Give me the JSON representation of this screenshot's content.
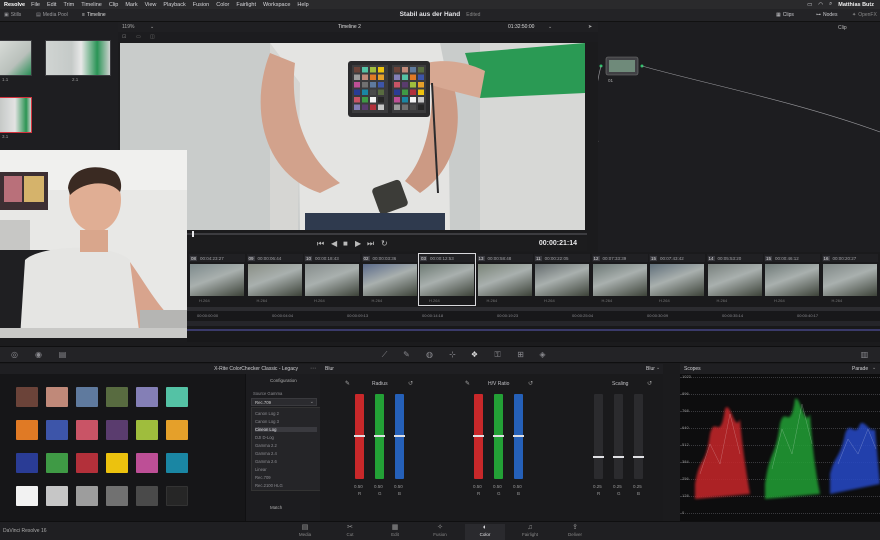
{
  "menubar": {
    "app": "Resolve",
    "items": [
      "File",
      "Edit",
      "Trim",
      "Timeline",
      "Clip",
      "Mark",
      "View",
      "Playback",
      "Fusion",
      "Color",
      "Fairlight",
      "Workspace",
      "Help"
    ],
    "user": "Matthias Butz"
  },
  "toolbar": {
    "left_buttons": [
      "Stills",
      "Media Pool",
      "Timeline"
    ],
    "project_title": "Stabil aus der Hand",
    "project_status": "Edited",
    "right_buttons": [
      "Clips",
      "Nodes",
      "OpenFX"
    ]
  },
  "viewer": {
    "zoom": "119%",
    "timeline_name": "Timeline 2",
    "source_timecode": "01:32:50:00",
    "current_timecode": "00:00:21:14",
    "clip_label": "Clip"
  },
  "gallery": {
    "items": [
      "1.1",
      "2.1",
      "3.1"
    ]
  },
  "node_graph": {
    "node_label": "01"
  },
  "clips": [
    {
      "num": "08",
      "tc": "00:04:23:27",
      "codec": "H.264"
    },
    {
      "num": "09",
      "tc": "00:00:06:44",
      "codec": "H.264"
    },
    {
      "num": "10",
      "tc": "00:00:18:43",
      "codec": "H.264"
    },
    {
      "num": "02",
      "tc": "00:00:03:36",
      "codec": "H.264"
    },
    {
      "num": "03",
      "tc": "00:00:12:53",
      "codec": "H.264"
    },
    {
      "num": "13",
      "tc": "00:00:58:48",
      "codec": "H.264"
    },
    {
      "num": "11",
      "tc": "00:00:22:05",
      "codec": "H.264"
    },
    {
      "num": "12",
      "tc": "00:07:33:39",
      "codec": "H.264"
    },
    {
      "num": "15",
      "tc": "00:07:43:42",
      "codec": "H.264"
    },
    {
      "num": "14",
      "tc": "00:05:53:20",
      "codec": "H.264"
    },
    {
      "num": "15",
      "tc": "00:00:46:12",
      "codec": "H.264"
    },
    {
      "num": "16",
      "tc": "00:00:20:27",
      "codec": "H.264"
    }
  ],
  "mini_timeline": {
    "marks": [
      "00:00:00:00",
      "00:00:04:04",
      "00:00:09:13",
      "00:00:14:18",
      "00:00:19:23",
      "00:00:25:04",
      "00:00:30:09",
      "00:00:35:14",
      "00:00:40:17"
    ]
  },
  "checker": {
    "title": "X-Rite ColorChecker Classic - Legacy",
    "config_label": "Configuration",
    "gamma_label": "Source Gamma",
    "gamma_value": "Rec.709",
    "gamma_options": [
      "Canon Log 2",
      "Canon Log 3",
      "Cineon Log",
      "DJI D-Log",
      "Gamma 2.2",
      "Gamma 2.4",
      "Gamma 2.6",
      "Linear",
      "Rec.709",
      "Rec.2100 HLG"
    ],
    "match_label": "Match",
    "patches": [
      "#6b4339",
      "#c08979",
      "#5f7a9e",
      "#586b40",
      "#847fb6",
      "#54c2a5",
      "#e07a25",
      "#3d55a9",
      "#c95466",
      "#5a3c6e",
      "#9fbd3d",
      "#e5a02a",
      "#2a3c95",
      "#3f9a45",
      "#b3303a",
      "#ecc20e",
      "#bd4f96",
      "#1a86a3",
      "#f2f2f2",
      "#c6c6c6",
      "#9d9d9d",
      "#717171",
      "#4a4a4a",
      "#262626"
    ]
  },
  "blur": {
    "title": "Blur",
    "mode": "Blur",
    "radius_label": "Radius",
    "hv_ratio_label": "H/V Ratio",
    "scaling_label": "Scaling",
    "radius_values": [
      "0.50",
      "0.50",
      "0.50"
    ],
    "hv_values": [
      "0.50",
      "0.50",
      "0.50"
    ],
    "scaling_values": [
      "0.25",
      "0.25",
      "0.25"
    ],
    "channel_labels": [
      "R",
      "G",
      "B"
    ]
  },
  "scopes": {
    "title": "Scopes",
    "mode": "Parade",
    "scale": [
      "1023",
      "896",
      "768",
      "640",
      "512",
      "384",
      "256",
      "128",
      "0"
    ]
  },
  "pages": [
    "Media",
    "Cut",
    "Edit",
    "Fusion",
    "Color",
    "Fairlight",
    "Deliver"
  ],
  "active_page": "Color",
  "version": "DaVinci Resolve 16",
  "colors": {
    "accent": "#e0e0e4",
    "red": "#c8282a",
    "green": "#23a036",
    "blue": "#2560b8"
  }
}
